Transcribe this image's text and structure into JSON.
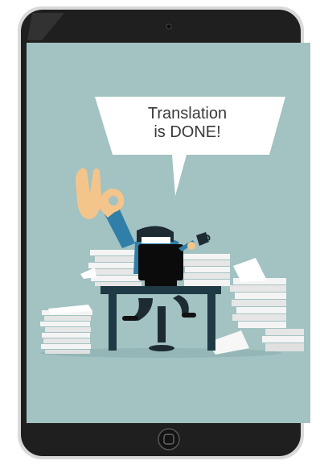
{
  "speech_bubble": {
    "line1": "Translation",
    "line2": "is DONE!"
  },
  "colors": {
    "tablet_body": "#1f1f1f",
    "screen_background": "#a3c2c2",
    "desk": "#1f3a44",
    "paper": "#f2f2f2",
    "jacket": "#2f7fa8",
    "skin": "#f4c58a"
  },
  "icons": [
    "camera-icon",
    "home-button-icon",
    "ok-hand-icon",
    "coffee-cup-icon"
  ]
}
